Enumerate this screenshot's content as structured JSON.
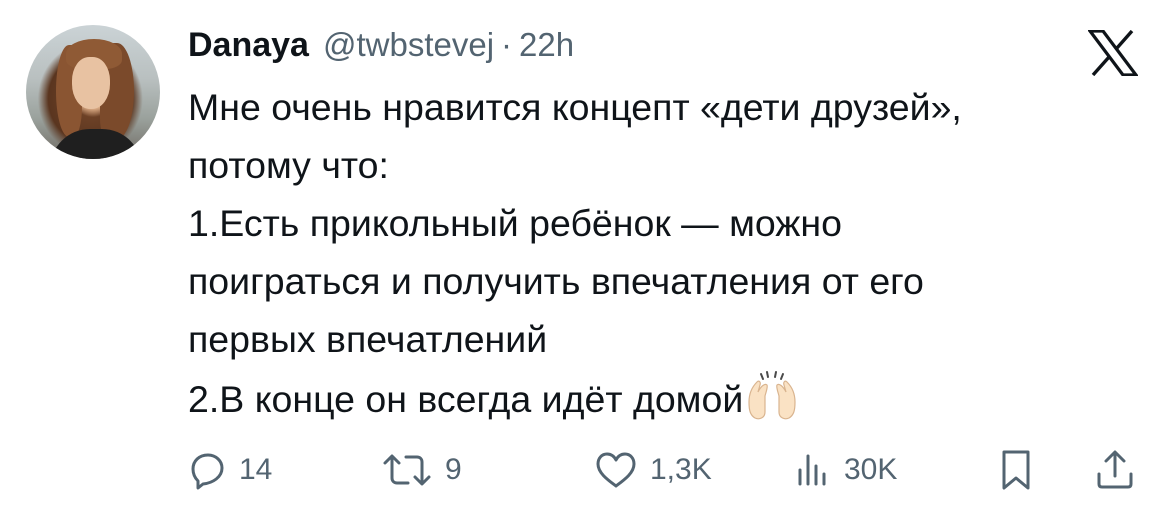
{
  "tweet": {
    "author": {
      "name": "Danaya",
      "handle": "@twbstevej",
      "separator": "·",
      "time": "22h"
    },
    "text_lines": [
      "Мне очень нравится концепт «дети друзей»,",
      "потому что:",
      "1.Есть прикольный ребёнок — можно",
      "поиграться и получить впечатления от его",
      "первых впечатлений",
      "2.В конце он всегда идёт домой"
    ],
    "emoji": "raising-hands",
    "metrics": {
      "replies": "14",
      "reposts": "9",
      "likes": "1,3K",
      "views": "30K"
    }
  },
  "colors": {
    "text": "#0f1419",
    "secondary": "#536471",
    "background": "#ffffff"
  }
}
